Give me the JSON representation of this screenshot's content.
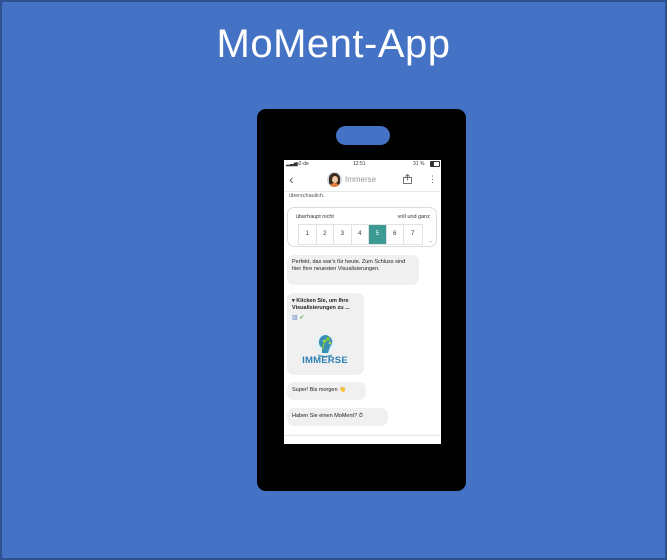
{
  "slide": {
    "title": "MoMent-App",
    "background_color": "#4472c4",
    "border_color": "#2f528f"
  },
  "phone": {
    "status_bar": {
      "carrier": "o2-de",
      "time": "12:51",
      "battery": "31 %"
    },
    "chat_header": {
      "back_icon": "chevron-left-icon",
      "name": "Immerse",
      "share_icon": "share-icon",
      "more_icon": "more-vertical-icon"
    },
    "messages": {
      "previous_fragment": "überschaulich.",
      "scale": {
        "left_label": "überhaupt nicht",
        "right_label": "voll und ganz",
        "options": [
          "1",
          "2",
          "3",
          "4",
          "5",
          "6",
          "7"
        ],
        "selected": "5",
        "selected_color": "#3c9a93"
      },
      "closing_message": "Perfekt, das war's für heute. Zum Schluss sind hier Ihre neuesten Visualisierungen.",
      "visualization_card": {
        "title": "▾ Klicken Sie, um Ihre Visualisierungen zu ...",
        "icons": [
          "chart-icon",
          "check-icon"
        ],
        "logo_text": "IMMERSE"
      },
      "goodbye_message": "Super! Bis morgen 👋",
      "question_message": "Haben Sie einen MoMent? ⏱"
    }
  }
}
